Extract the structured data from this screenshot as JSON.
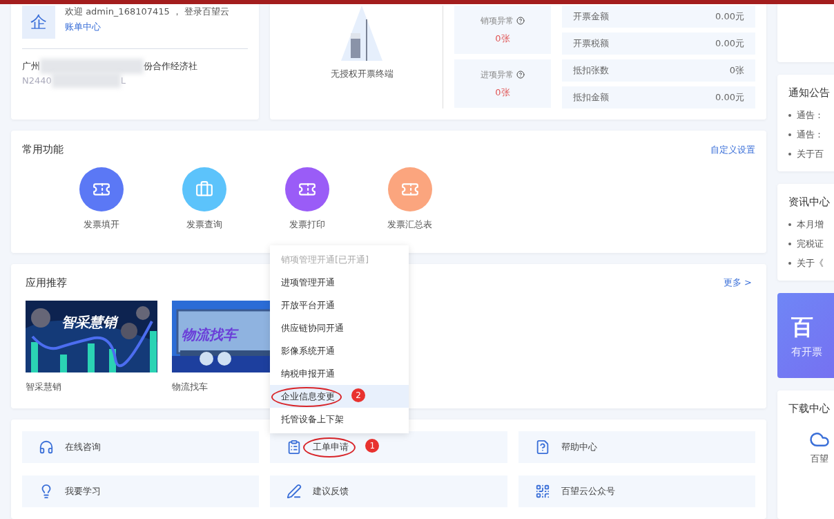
{
  "account": {
    "logo": "企",
    "welcome": "欢迎 admin_168107415 ， 登录百望云",
    "link": "账单中心",
    "company_parts": [
      "广州",
      "份合作经济社"
    ],
    "tax_id_parts": [
      "N2440",
      "L"
    ]
  },
  "terminal": {
    "label": "无授权开票终端"
  },
  "anomalies": [
    {
      "label": "销项异常",
      "value": "0张"
    },
    {
      "label": "进项异常",
      "value": "0张"
    }
  ],
  "stats": [
    {
      "label": "开票金额",
      "value": "0.00元"
    },
    {
      "label": "开票税额",
      "value": "0.00元"
    },
    {
      "label": "抵扣张数",
      "value": "0张"
    },
    {
      "label": "抵扣金额",
      "value": "0.00元"
    }
  ],
  "common_functions": {
    "title": "常用功能",
    "action": "自定义设置",
    "items": [
      {
        "label": "发票填开",
        "color": "#5b78f5",
        "kind": "ticket"
      },
      {
        "label": "发票查询",
        "color": "#5cc3fb",
        "kind": "briefcase"
      },
      {
        "label": "发票打印",
        "color": "#9a5cf7",
        "kind": "ticket"
      },
      {
        "label": "发票汇总表",
        "color": "#fba57e",
        "kind": "ticket"
      }
    ]
  },
  "apps": {
    "title": "应用推荐",
    "more": "更多 >",
    "items": [
      {
        "label": "智采慧销",
        "banner": "智采慧销",
        "kind": "chart"
      },
      {
        "label": "物流找车",
        "banner": "物流找车",
        "kind": "truck"
      }
    ]
  },
  "menu": {
    "items": [
      {
        "label": "销项管理开通[已开通]",
        "disabled": true,
        "selected": false
      },
      {
        "label": "进项管理开通",
        "disabled": false,
        "selected": false
      },
      {
        "label": "开放平台开通",
        "disabled": false,
        "selected": false
      },
      {
        "label": "供应链协同开通",
        "disabled": false,
        "selected": false
      },
      {
        "label": "影像系统开通",
        "disabled": false,
        "selected": false
      },
      {
        "label": "纳税申报开通",
        "disabled": false,
        "selected": false
      },
      {
        "label": "企业信息变更",
        "disabled": false,
        "selected": true,
        "annotation": "2"
      },
      {
        "label": "托管设备上下架",
        "disabled": false,
        "selected": false
      }
    ]
  },
  "shortcuts": [
    {
      "label": "在线咨询",
      "kind": "headset"
    },
    {
      "label": "工单申请",
      "kind": "form",
      "annotation": "1"
    },
    {
      "label": "帮助中心",
      "kind": "help"
    },
    {
      "label": "我要学习",
      "kind": "bulb"
    },
    {
      "label": "建议反馈",
      "kind": "pen"
    },
    {
      "label": "百望云公众号",
      "kind": "qr"
    }
  ],
  "sidebar": {
    "notice": {
      "title": "通知公告",
      "items": [
        "通告：",
        "通告：",
        "关于百"
      ]
    },
    "news": {
      "title": "资讯中心",
      "items": [
        "本月增",
        "完税证",
        "关于《"
      ]
    },
    "promo": {
      "title": "百",
      "subtitle": "有开票"
    },
    "download": {
      "title": "下载中心",
      "items": [
        "百望"
      ]
    }
  }
}
